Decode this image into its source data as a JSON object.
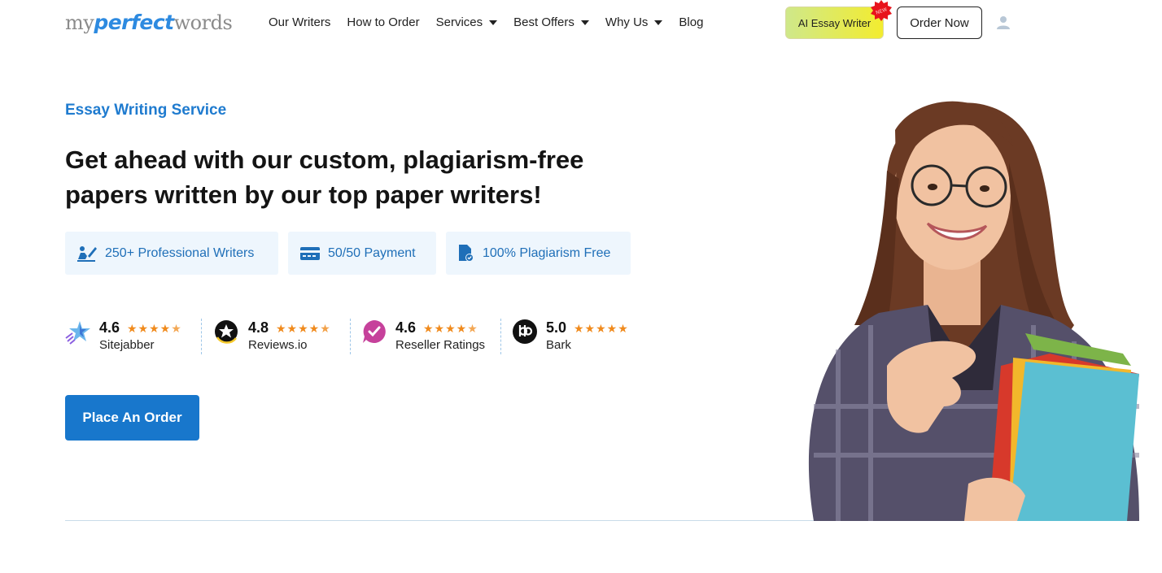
{
  "logo": {
    "part1": "my",
    "part2": "perfect",
    "part3": "words"
  },
  "nav": {
    "items": [
      {
        "label": "Our Writers",
        "dropdown": false
      },
      {
        "label": "How to Order",
        "dropdown": false
      },
      {
        "label": "Services",
        "dropdown": true
      },
      {
        "label": "Best Offers",
        "dropdown": true
      },
      {
        "label": "Why Us",
        "dropdown": true
      },
      {
        "label": "Blog",
        "dropdown": false
      }
    ]
  },
  "header": {
    "ai_button": "AI Essay Writer",
    "new_badge": "NEW",
    "order_now": "Order Now",
    "user_icon": "user-icon"
  },
  "hero": {
    "eyebrow": "Essay Writing Service",
    "headline_line1": "Get ahead with our custom, plagiarism-free",
    "headline_line2": "papers written by our top paper writers!",
    "features": [
      {
        "label": "250+ Professional Writers",
        "icon": "writer-icon"
      },
      {
        "label": "50/50 Payment",
        "icon": "card-icon"
      },
      {
        "label": "100% Plagiarism Free",
        "icon": "document-check-icon"
      }
    ],
    "ratings": [
      {
        "score": "4.6",
        "site": "Sitejabber",
        "stars": 4.6,
        "icon": "sitejabber-icon"
      },
      {
        "score": "4.8",
        "site": "Reviews.io",
        "stars": 4.8,
        "icon": "reviewsio-icon"
      },
      {
        "score": "4.6",
        "site": "Reseller Ratings",
        "stars": 4.6,
        "icon": "resellerratings-icon"
      },
      {
        "score": "5.0",
        "site": "Bark",
        "stars": 5.0,
        "icon": "bark-icon"
      }
    ],
    "cta": "Place An Order"
  },
  "colors": {
    "accent": "#1877cc",
    "eyebrow": "#1f7bcf",
    "feature_bg": "#eef6fd",
    "star": "#f08a1c"
  }
}
